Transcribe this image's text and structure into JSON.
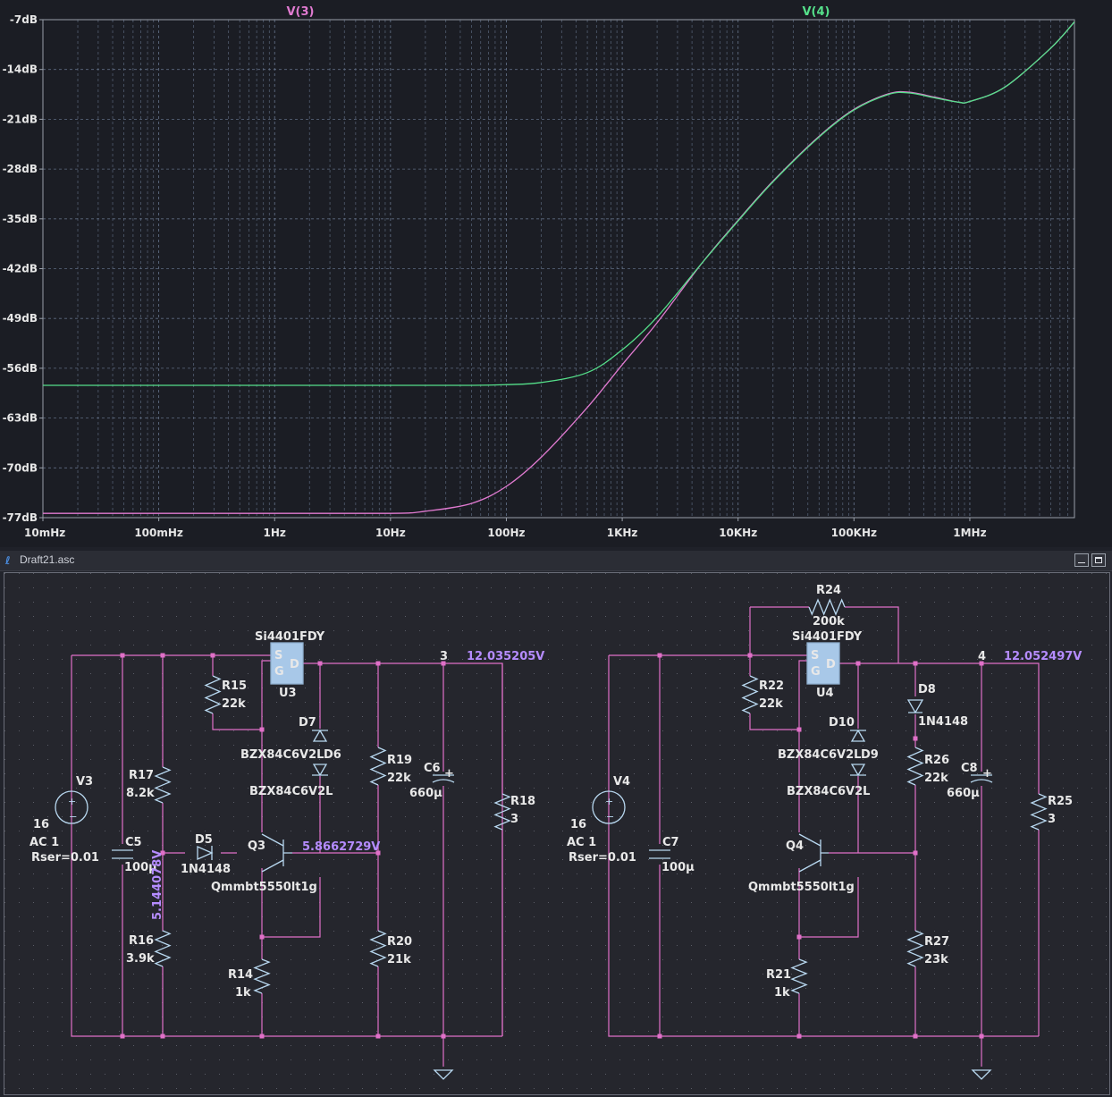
{
  "plot": {
    "traces": [
      {
        "name": "V(3)",
        "color": "#e07ad0"
      },
      {
        "name": "V(4)",
        "color": "#55e08a"
      }
    ],
    "y_ticks": [
      "-7dB",
      "-14dB",
      "-21dB",
      "-28dB",
      "-35dB",
      "-42dB",
      "-49dB",
      "-56dB",
      "-63dB",
      "-70dB",
      "-77dB"
    ],
    "x_ticks": [
      "10mHz",
      "100mHz",
      "1Hz",
      "10Hz",
      "100Hz",
      "1KHz",
      "10KHz",
      "100KHz",
      "1MHz"
    ],
    "colors": {
      "background": "#1b1d24",
      "grid": "#6f7f99",
      "frame": "#9aa0aa"
    }
  },
  "chart_data": {
    "type": "line",
    "xscale": "log",
    "x_unit": "Hz",
    "y_unit": "dB",
    "xlim": [
      0.01,
      8000000
    ],
    "ylim": [
      -77,
      -7
    ],
    "grid": true,
    "series": [
      {
        "name": "V(3)",
        "color": "#e07ad0",
        "points": [
          [
            0.01,
            -76.4
          ],
          [
            1,
            -76.4
          ],
          [
            10,
            -76.4
          ],
          [
            20,
            -76.1
          ],
          [
            50,
            -75.0
          ],
          [
            100,
            -72.6
          ],
          [
            200,
            -68.5
          ],
          [
            500,
            -61.5
          ],
          [
            1000,
            -55.5
          ],
          [
            2000,
            -49.6
          ],
          [
            5000,
            -41.0
          ],
          [
            10000,
            -35.2
          ],
          [
            20000,
            -29.7
          ],
          [
            50000,
            -23.4
          ],
          [
            100000,
            -19.6
          ],
          [
            200000,
            -17.4
          ],
          [
            300000,
            -17.2
          ],
          [
            500000,
            -17.9
          ],
          [
            800000,
            -18.6
          ],
          [
            1000000,
            -18.5
          ],
          [
            2000000,
            -16.5
          ],
          [
            5000000,
            -11.0
          ],
          [
            8000000,
            -7.3
          ]
        ]
      },
      {
        "name": "V(4)",
        "color": "#55e08a",
        "points": [
          [
            0.01,
            -58.4
          ],
          [
            1,
            -58.4
          ],
          [
            10,
            -58.4
          ],
          [
            50,
            -58.4
          ],
          [
            100,
            -58.3
          ],
          [
            200,
            -58.0
          ],
          [
            500,
            -56.6
          ],
          [
            1000,
            -53.4
          ],
          [
            2000,
            -48.8
          ],
          [
            5000,
            -41.0
          ],
          [
            10000,
            -35.3
          ],
          [
            20000,
            -29.8
          ],
          [
            50000,
            -23.5
          ],
          [
            100000,
            -19.7
          ],
          [
            200000,
            -17.5
          ],
          [
            300000,
            -17.3
          ],
          [
            500000,
            -18.0
          ],
          [
            800000,
            -18.6
          ],
          [
            1000000,
            -18.5
          ],
          [
            2000000,
            -16.5
          ],
          [
            5000000,
            -11.0
          ],
          [
            8000000,
            -7.3
          ]
        ]
      }
    ]
  },
  "schematic": {
    "window_title": "Draft21.asc",
    "labels": {
      "u3_part": "Si4401FDY",
      "u3_ref": "U3",
      "u4_part": "Si4401FDY",
      "u4_ref": "U4",
      "pin_s": "S",
      "pin_g": "G",
      "pin_d": "D",
      "r15": "R15",
      "r15_val": "22k",
      "r17": "R17",
      "r17_val": "8.2k",
      "r16": "R16",
      "r16_val": "3.9k",
      "r14": "R14",
      "r14_val": "1k",
      "r19": "R19",
      "r19_val": "22k",
      "r20": "R20",
      "r20_val": "21k",
      "r18": "R18",
      "r18_val": "3",
      "c6": "C6",
      "c6_val": "660µ",
      "c5": "C5",
      "c5_val": "100µ",
      "v3": "V3",
      "v3_val": "16",
      "v3_ac": "AC 1",
      "v3_rser": "Rser=0.01",
      "d5": "D5",
      "d5_val": "1N4148",
      "d7": "D7",
      "d6": "D6",
      "d6_val": "BZX84C6V2L",
      "d7_val": "BZX84C6V2L",
      "q3": "Q3",
      "q3_val": "Qmmbt5550lt1g",
      "net3": "3",
      "v_out3": "12.035205V",
      "v_q3": "5.8662729V",
      "v_div": "5.144078V",
      "r24": "R24",
      "r24_val": "200k",
      "r22": "R22",
      "r22_val": "22k",
      "r21": "R21",
      "r21_val": "1k",
      "r26": "R26",
      "r26_val": "22k",
      "r27": "R27",
      "r27_val": "23k",
      "r25": "R25",
      "r25_val": "3",
      "c8": "C8",
      "c8_val": "660µ",
      "c7": "C7",
      "c7_val": "100µ",
      "v4": "V4",
      "v4_val": "16",
      "v4_ac": "AC 1",
      "v4_rser": "Rser=0.01",
      "d8": "D8",
      "d8_val": "1N4148",
      "d10": "D10",
      "d9": "D9",
      "d9_val": "BZX84C6V2L",
      "d10_val": "BZX84C6V2L",
      "q4": "Q4",
      "q4_val": "Qmmbt5550lt1g",
      "net4": "4",
      "v_out4": "12.052497V"
    },
    "colors": {
      "wire": "#e070c8",
      "part": "#b8d8f0",
      "node": "#e070c8",
      "ic_fill": "#a8c8e8"
    }
  }
}
